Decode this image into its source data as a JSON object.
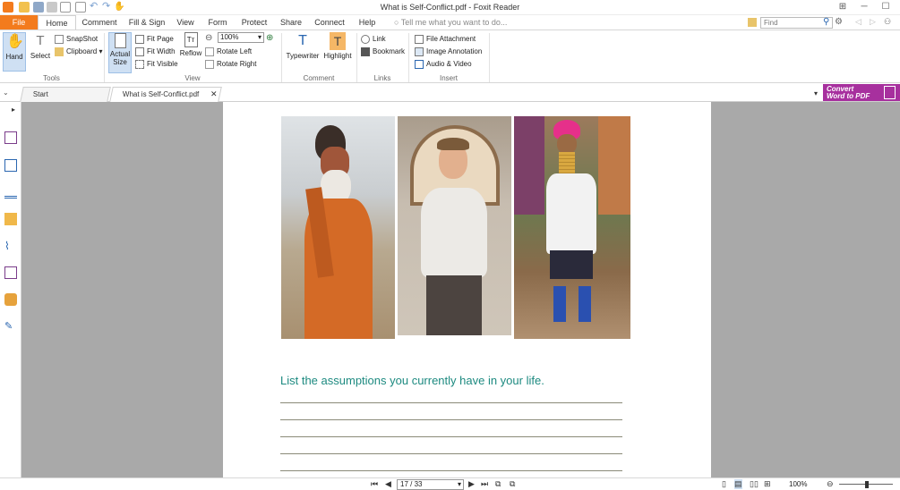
{
  "window": {
    "title": "What is Self-Conflict.pdf - Foxit Reader"
  },
  "menu_tabs": [
    "File",
    "Home",
    "Comment",
    "Fill & Sign",
    "View",
    "Form",
    "Protect",
    "Share",
    "Connect",
    "Help"
  ],
  "tell_me": {
    "placeholder": "Tell me what you want to do..."
  },
  "find": {
    "placeholder": "Find"
  },
  "ribbon": {
    "tools": {
      "hand": "Hand",
      "select": "Select",
      "snapshot": "SnapShot",
      "clipboard": "Clipboard",
      "group": "Tools"
    },
    "view": {
      "actual_size_1": "Actual",
      "actual_size_2": "Size",
      "fit_page": "Fit Page",
      "fit_width": "Fit Width",
      "fit_visible": "Fit Visible",
      "reflow": "Reflow",
      "zoom_value": "100%",
      "rotate_left": "Rotate Left",
      "rotate_right": "Rotate Right",
      "group": "View"
    },
    "comment": {
      "typewriter": "Typewriter",
      "highlight": "Highlight",
      "group": "Comment"
    },
    "links": {
      "link": "Link",
      "bookmark": "Bookmark",
      "group": "Links"
    },
    "insert": {
      "file_attachment": "File Attachment",
      "image_annotation": "Image Annotation",
      "audio_video": "Audio & Video",
      "group": "Insert"
    }
  },
  "doc_tabs": {
    "start": "Start",
    "current": "What is Self-Conflict.pdf"
  },
  "convert_banner": {
    "line1": "Convert",
    "line2": "Word to PDF"
  },
  "document": {
    "prompt": "List the assumptions you currently have in your life."
  },
  "status": {
    "page": "17 / 33",
    "zoom": "100%"
  },
  "colors": {
    "accent": "#f37b1d",
    "banner": "#a7309e",
    "prompt_text": "#1d8a80"
  }
}
